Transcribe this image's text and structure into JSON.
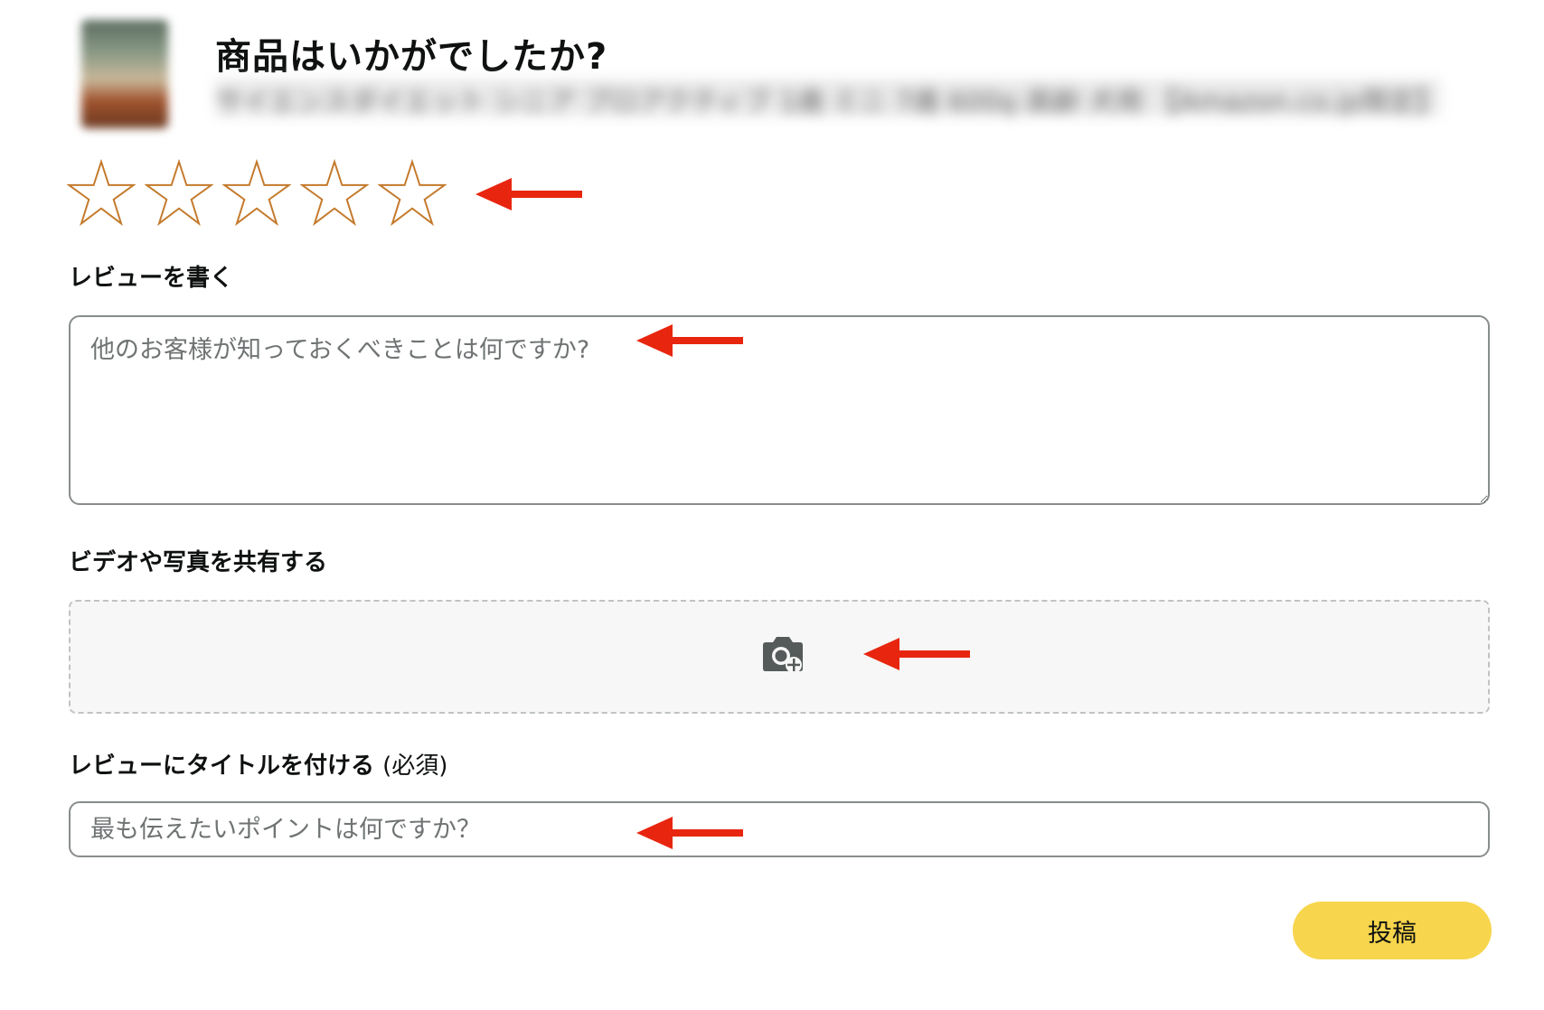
{
  "header": {
    "title": "商品はいかがでしたか?",
    "product_name": "サイエンスダイエット シニア プロアクティブ 1歳 ミニ 7歳 600g 高齢 犬用 【Amazon.co.jp限定】"
  },
  "rating": {
    "max_stars": 5,
    "selected": 0,
    "star_color": "#c47a2c"
  },
  "review": {
    "label": "レビューを書く",
    "placeholder": "他のお客様が知っておくべきことは何ですか?"
  },
  "media": {
    "label": "ビデオや写真を共有する",
    "icon": "camera-plus-icon"
  },
  "title_field": {
    "label": "レビューにタイトルを付ける",
    "required_note": "(必須)",
    "placeholder": "最も伝えたいポイントは何ですか？"
  },
  "submit": {
    "label": "投稿",
    "color": "#f7d54c"
  },
  "annotation": {
    "arrow_color": "#e8260f"
  }
}
